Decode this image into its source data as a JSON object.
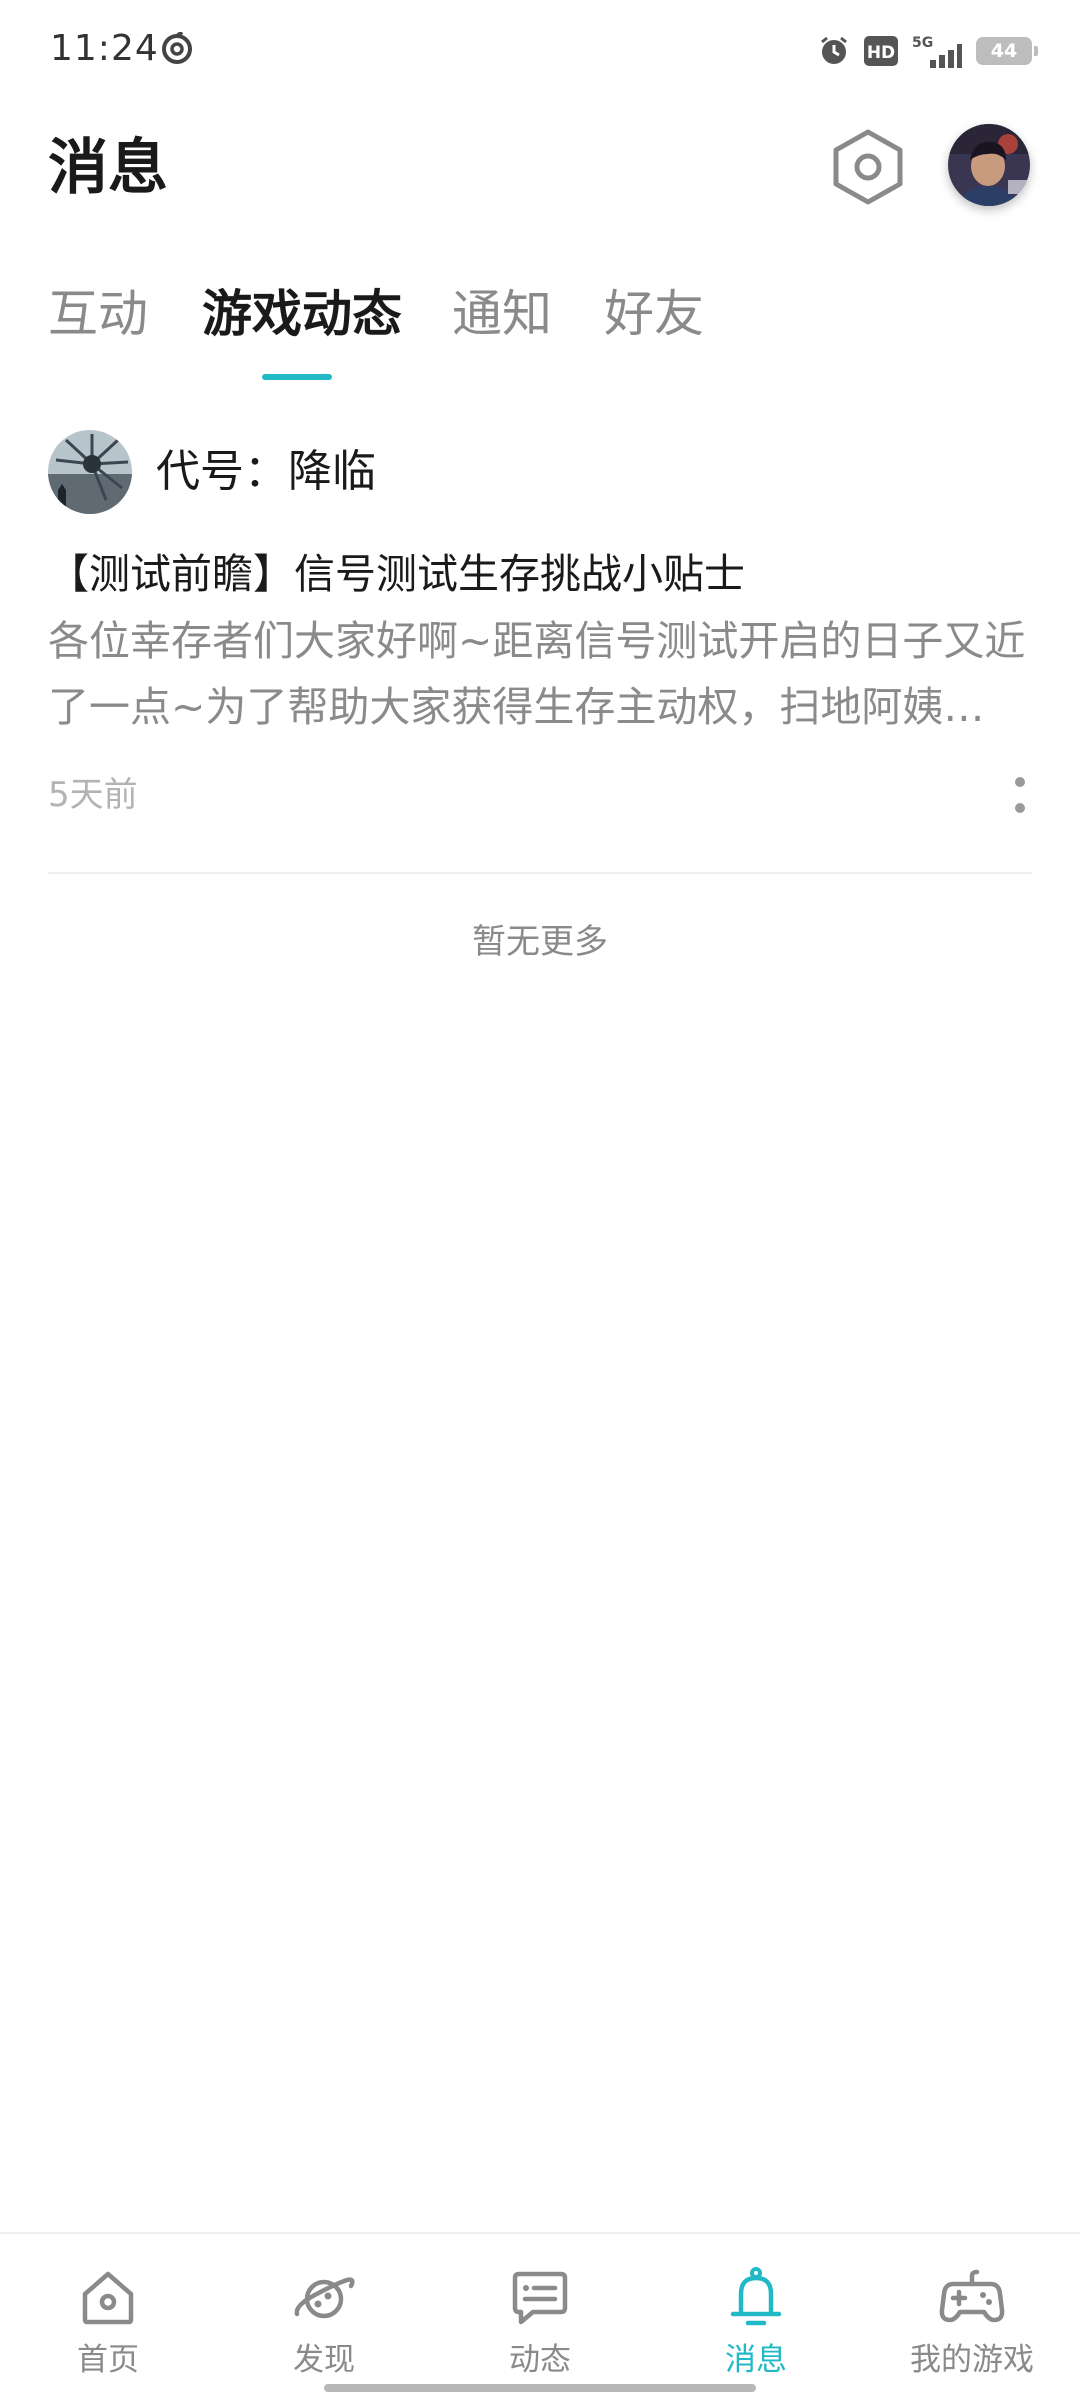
{
  "status_bar": {
    "time": "11:24",
    "hd_badge": "HD",
    "network": "5G",
    "battery": "44"
  },
  "header": {
    "title": "消息"
  },
  "tabs": [
    {
      "label": "互动",
      "active": false
    },
    {
      "label": "游戏动态",
      "active": true
    },
    {
      "label": "通知",
      "active": false
    },
    {
      "label": "好友",
      "active": false
    }
  ],
  "feed": [
    {
      "game_name": "代号：降临",
      "title": "【测试前瞻】信号测试生存挑战小贴士",
      "summary": "各位幸存者们大家好啊~距离信号测试开启的日子又近了一点~为了帮助大家获得生存主动权，扫地阿姨…",
      "time": "5天前"
    }
  ],
  "no_more_text": "暂无更多",
  "bottom_nav": [
    {
      "label": "首页",
      "icon": "home-icon",
      "active": false
    },
    {
      "label": "发现",
      "icon": "planet-icon",
      "active": false
    },
    {
      "label": "动态",
      "icon": "chat-icon",
      "active": false
    },
    {
      "label": "消息",
      "icon": "bell-icon",
      "active": true
    },
    {
      "label": "我的游戏",
      "icon": "gamepad-icon",
      "active": false
    }
  ],
  "colors": {
    "accent": "#21b9c6",
    "text_primary": "#1a1a1a",
    "text_secondary": "#8a8a8a",
    "text_tertiary": "#b3b3b3"
  }
}
